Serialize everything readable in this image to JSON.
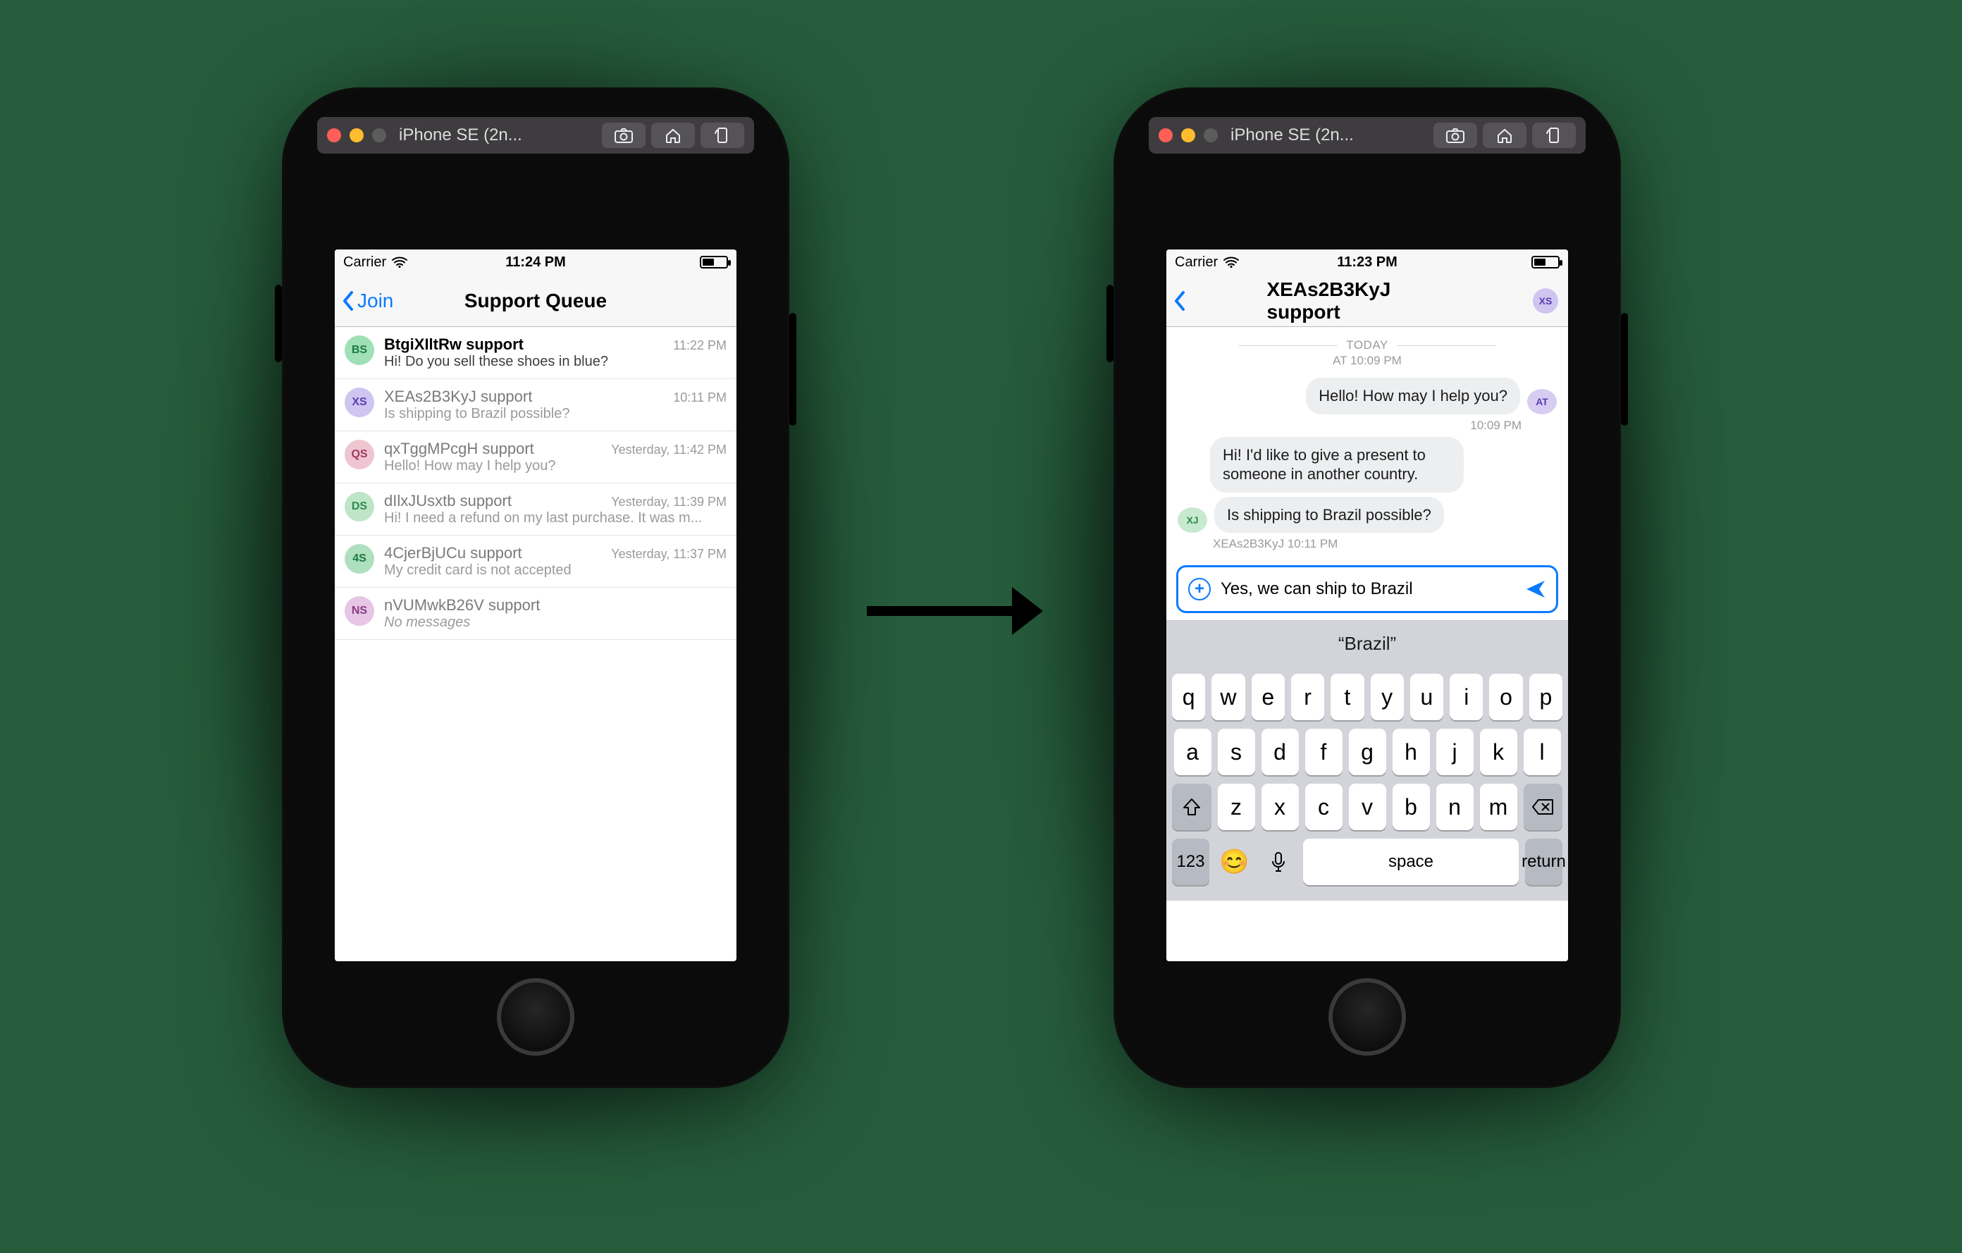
{
  "simulator": {
    "title": "iPhone SE (2n..."
  },
  "avatar_colors": {
    "BS": {
      "bg": "#9fe0b6",
      "fg": "#1e7a3e"
    },
    "XS": {
      "bg": "#cfc5f0",
      "fg": "#5a3db5"
    },
    "QS": {
      "bg": "#efc5d2",
      "fg": "#a13a5e"
    },
    "DS": {
      "bg": "#bfe5c8",
      "fg": "#2f8a4e"
    },
    "4S": {
      "bg": "#aee0c0",
      "fg": "#1e7a3e"
    },
    "NS": {
      "bg": "#e6c5e5",
      "fg": "#8a3d86"
    },
    "AT": {
      "bg": "#d7cdf2",
      "fg": "#5a3db5"
    },
    "XJ": {
      "bg": "#c7e9cf",
      "fg": "#2f8a4e"
    }
  },
  "left": {
    "status": {
      "carrier": "Carrier",
      "time": "11:24 PM"
    },
    "nav": {
      "back_label": "Join",
      "title": "Support Queue"
    },
    "conversations": [
      {
        "initials": "BS",
        "title": "BtgiXIltRw support",
        "time": "11:22 PM",
        "preview": "Hi! Do you sell these shoes in blue?",
        "unread": true,
        "italic": false
      },
      {
        "initials": "XS",
        "title": "XEAs2B3KyJ support",
        "time": "10:11 PM",
        "preview": "Is shipping to Brazil possible?",
        "unread": false,
        "italic": false
      },
      {
        "initials": "QS",
        "title": "qxTggMPcgH support",
        "time": "Yesterday, 11:42 PM",
        "preview": "Hello! How may I help you?",
        "unread": false,
        "italic": false
      },
      {
        "initials": "DS",
        "title": "dIlxJUsxtb support",
        "time": "Yesterday, 11:39 PM",
        "preview": "Hi! I need a refund on my last purchase. It was m...",
        "unread": false,
        "italic": false
      },
      {
        "initials": "4S",
        "title": "4CjerBjUCu support",
        "time": "Yesterday, 11:37 PM",
        "preview": "My credit card is not accepted",
        "unread": false,
        "italic": false
      },
      {
        "initials": "NS",
        "title": "nVUMwkB26V support",
        "time": "",
        "preview": "No messages",
        "unread": false,
        "italic": true
      }
    ]
  },
  "right": {
    "status": {
      "carrier": "Carrier",
      "time": "11:23 PM"
    },
    "nav": {
      "title": "XEAs2B3KyJ support",
      "avatar_initials": "XS"
    },
    "day_label": "TODAY",
    "day_time": "AT 10:09 PM",
    "messages": [
      {
        "side": "right",
        "text": "Hello! How may I help you?",
        "avatar": "AT"
      },
      {
        "meta_side": "right",
        "meta": "10:09 PM"
      },
      {
        "side": "left",
        "text": "Hi! I'd like to give a present to someone in another country."
      },
      {
        "side": "left",
        "text": "Is shipping to Brazil possible?",
        "avatar": "XJ"
      },
      {
        "meta_side": "left",
        "meta": "XEAs2B3KyJ 10:11 PM"
      }
    ],
    "composer": {
      "value": "Yes, we can ship to Brazil"
    },
    "suggestion": "“Brazil”",
    "keyboard": {
      "row1": [
        "q",
        "w",
        "e",
        "r",
        "t",
        "y",
        "u",
        "i",
        "o",
        "p"
      ],
      "row2": [
        "a",
        "s",
        "d",
        "f",
        "g",
        "h",
        "j",
        "k",
        "l"
      ],
      "row3": [
        "z",
        "x",
        "c",
        "v",
        "b",
        "n",
        "m"
      ],
      "num": "123",
      "space": "space",
      "return": "return"
    }
  }
}
